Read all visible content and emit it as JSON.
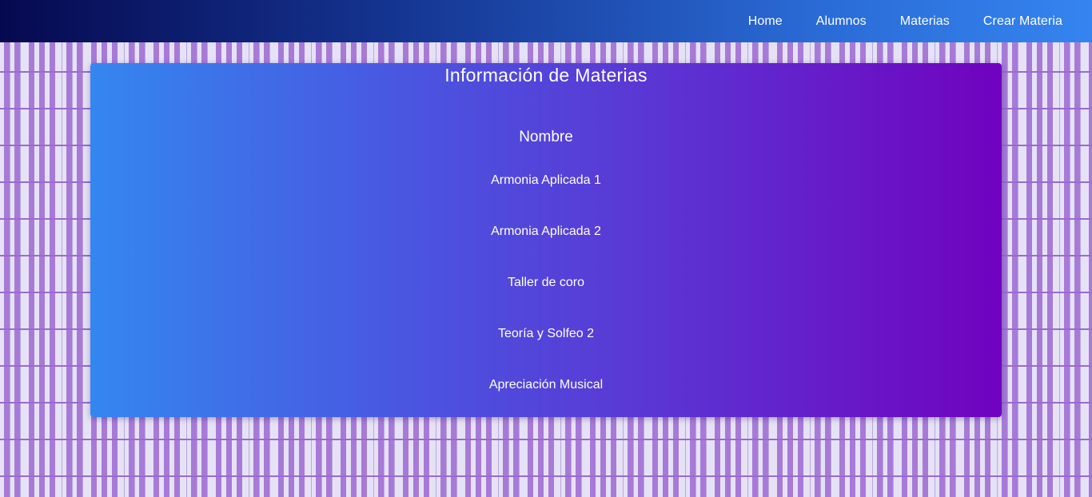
{
  "nav": {
    "links": [
      {
        "label": "Home"
      },
      {
        "label": "Alumnos"
      },
      {
        "label": "Materias"
      },
      {
        "label": "Crear Materia"
      }
    ]
  },
  "main": {
    "title": "Información de Materias",
    "column_header": "Nombre",
    "subjects": [
      {
        "name": "Armonia Aplicada 1"
      },
      {
        "name": "Armonia Aplicada 2"
      },
      {
        "name": "Taller de coro"
      },
      {
        "name": "Teoría y Solfeo 2"
      },
      {
        "name": "Apreciación Musical"
      }
    ]
  },
  "colors": {
    "navbar_start": "#06094f",
    "navbar_end": "#3584ef",
    "card_start": "#3486f0",
    "card_end": "#7002bf",
    "background_keys": "#a87ad8"
  }
}
